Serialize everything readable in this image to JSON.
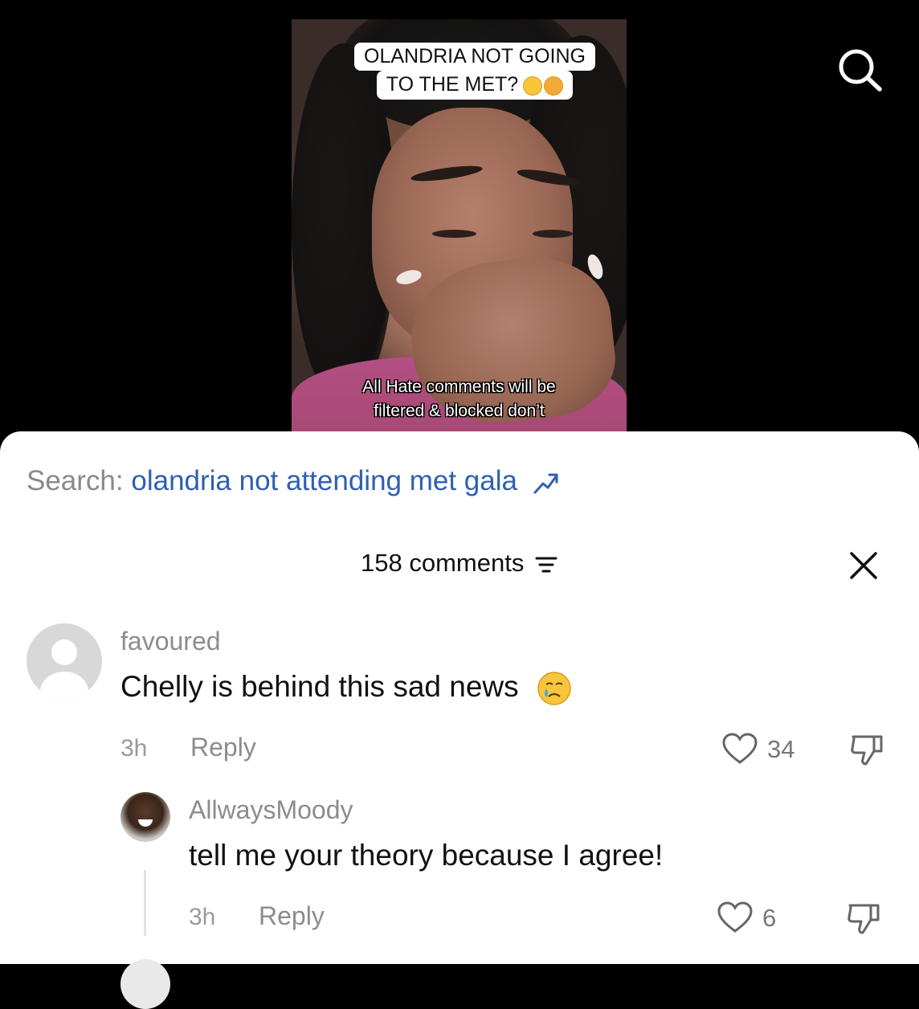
{
  "video": {
    "caption_top_line1": "OLANDRIA NOT GOING",
    "caption_top_line2": "TO THE MET?",
    "caption_bottom_line1": "All Hate comments will be",
    "caption_bottom_line2": "filtered & blocked don’t"
  },
  "header": {
    "search_icon": "search-icon"
  },
  "search_suggestion": {
    "prefix": "Search:",
    "query": "olandria not attending met gala",
    "icon": "trending-arrow-icon",
    "query_color": "#2f5fb3"
  },
  "comments_header": {
    "count_label": "158 comments",
    "filter_icon": "filter-icon",
    "close_icon": "close-icon"
  },
  "comments": [
    {
      "username": "favoured",
      "text": "Chelly is behind this sad news",
      "emoji": "crying-face",
      "time": "3h",
      "reply_label": "Reply",
      "likes": "34"
    }
  ],
  "replies": [
    {
      "username": "AllwaysMoody",
      "text": "tell me your theory because I agree!",
      "time": "3h",
      "reply_label": "Reply",
      "likes": "6"
    }
  ]
}
